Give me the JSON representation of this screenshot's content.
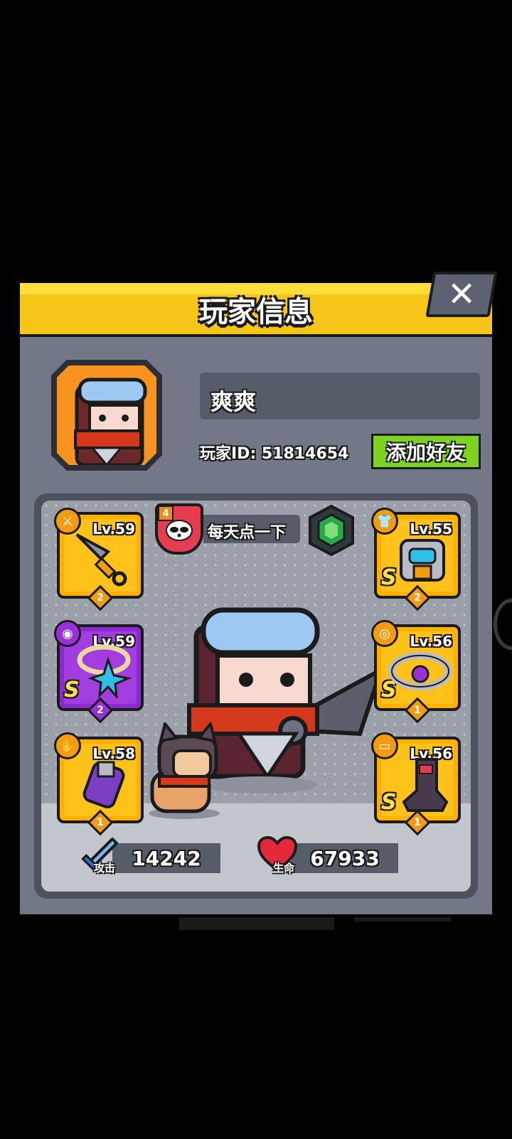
{
  "header": {
    "title": "玩家信息"
  },
  "profile": {
    "name": "爽爽",
    "id_label": "玩家ID: 51814654",
    "add_friend_label": "添加好友"
  },
  "guild": {
    "level": "4",
    "name": "每天点一下"
  },
  "equipment": {
    "weapon": {
      "type_icon": "sword-type",
      "level": "Lv.59",
      "grade": "",
      "stars": "2"
    },
    "necklace": {
      "type_icon": "necklace-type",
      "level": "Lv.59",
      "grade": "S",
      "stars": "2"
    },
    "gloves": {
      "type_icon": "glove-type",
      "level": "Lv.58",
      "grade": "",
      "stars": "1"
    },
    "armor": {
      "type_icon": "armor-type",
      "level": "Lv.55",
      "grade": "S",
      "stars": "2"
    },
    "belt": {
      "type_icon": "belt-type",
      "level": "Lv.56",
      "grade": "S",
      "stars": "1"
    },
    "boots": {
      "type_icon": "boot-type",
      "level": "Lv.56",
      "grade": "S",
      "stars": "1"
    }
  },
  "stats": {
    "attack": {
      "label": "攻击",
      "value": "14242"
    },
    "health": {
      "label": "生命",
      "value": "67933"
    }
  },
  "colors": {
    "header": "#f5c518",
    "dialog": "#727887",
    "add_button": "#7ed321",
    "slot_gold": "#ffc21a",
    "slot_purple": "#a23de0"
  }
}
